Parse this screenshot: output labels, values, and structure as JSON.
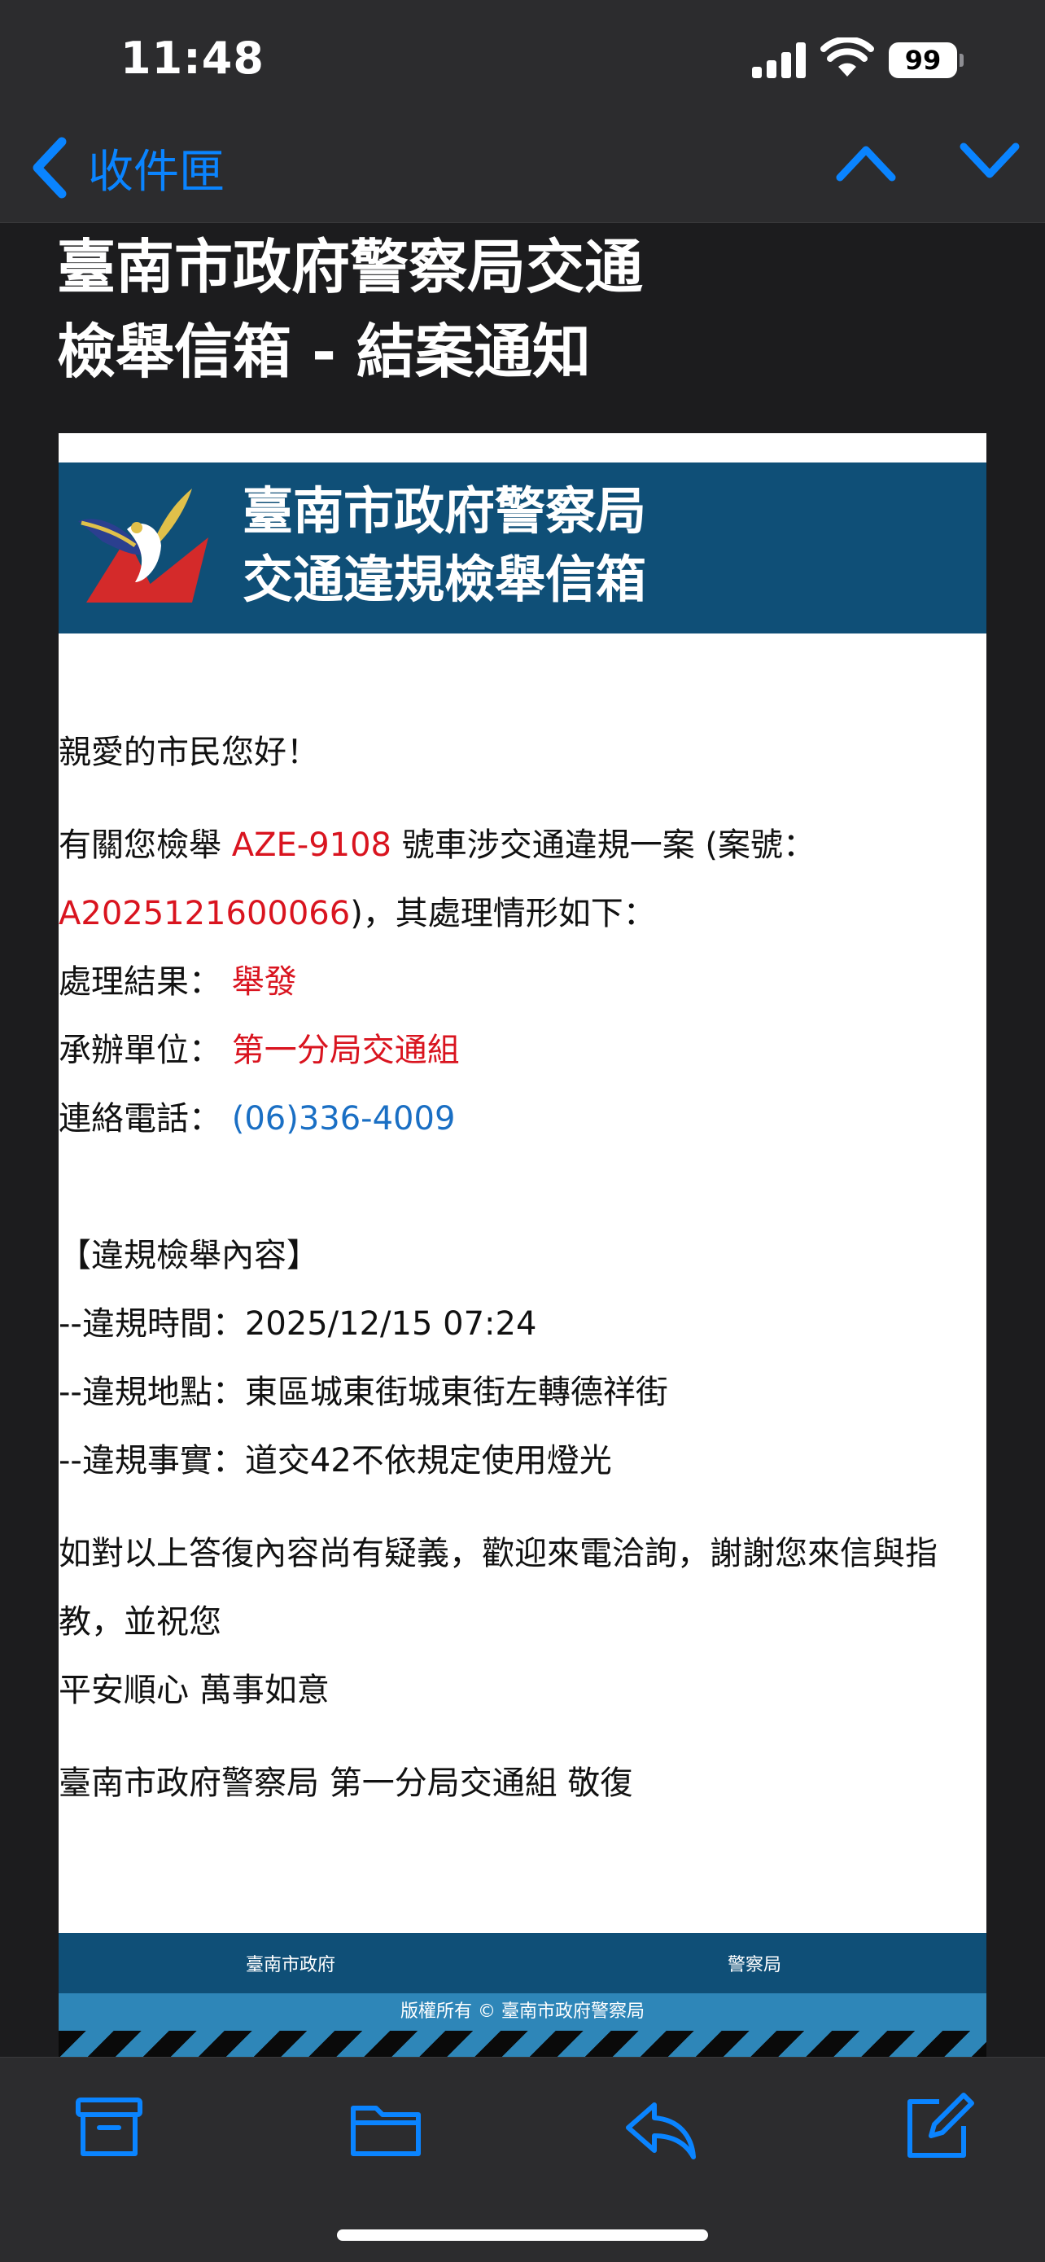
{
  "status_bar": {
    "time": "11:48",
    "battery": "99"
  },
  "nav": {
    "back_label": "收件匣"
  },
  "subject": {
    "line1": "臺南市政府警察局交通",
    "line2": "檢舉信箱 - 結案通知"
  },
  "banner": {
    "line1": "臺南市政府警察局",
    "line2": "交通違規檢舉信箱"
  },
  "body": {
    "greeting": "親愛的市民您好！",
    "intro_prefix": "有關您檢舉",
    "plate": "AZE-9108",
    "intro_mid": "號車涉交通違規一案 (案號：",
    "case_no": "A2025121600066",
    "intro_suffix": ")，其處理情形如下：",
    "result_label": "處理結果：",
    "result_value": "舉發",
    "unit_label": "承辦單位：",
    "unit_value": "第一分局交通組",
    "phone_label": "連絡電話：",
    "phone_value": "(06)336-4009",
    "content_header": "【違規檢舉內容】",
    "time_line": "--違規時間：2025/12/15 07:24",
    "place_line": "--違規地點：東區城東街城東街左轉德祥街",
    "fact_line": "--違規事實：道交42不依規定使用燈光",
    "closing1": "如對以上答復內容尚有疑義，歡迎來電洽詢，謝謝您來信與指教，並祝您",
    "closing2": "平安順心 萬事如意",
    "signature": "臺南市政府警察局 第一分局交通組 敬復"
  },
  "footer": {
    "link1": "臺南市政府",
    "link2": "警察局",
    "copyright": "版權所有 © 臺南市政府警察局"
  },
  "colors": {
    "accent_blue": "#0a84ff",
    "banner_navy": "#0f4f77",
    "highlight_red": "#d9141f",
    "phone_blue": "#1a6fc4",
    "footer_light_blue": "#2e86b8"
  },
  "toolbar": {
    "icons": [
      "archive-icon",
      "folder-icon",
      "reply-icon",
      "compose-icon"
    ]
  }
}
